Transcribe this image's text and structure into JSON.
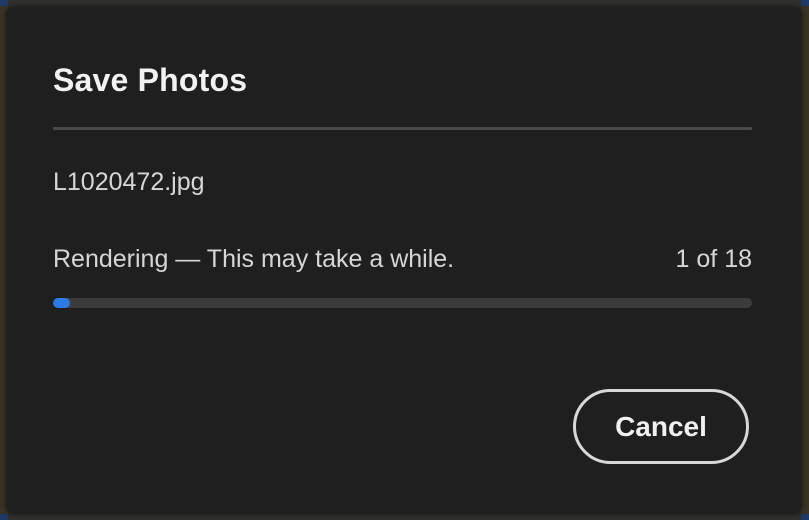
{
  "dialog": {
    "title": "Save Photos",
    "filename": "L1020472.jpg",
    "status_text": "Rendering — This may take a while.",
    "progress_count": "1 of 18",
    "progress_fraction": 0.025,
    "cancel_label": "Cancel"
  },
  "colors": {
    "dialog_background": "#1f1f1f",
    "progress_fill": "#2c7ae6",
    "progress_track": "#3c3c3c",
    "button_border": "#d8d8d8"
  }
}
